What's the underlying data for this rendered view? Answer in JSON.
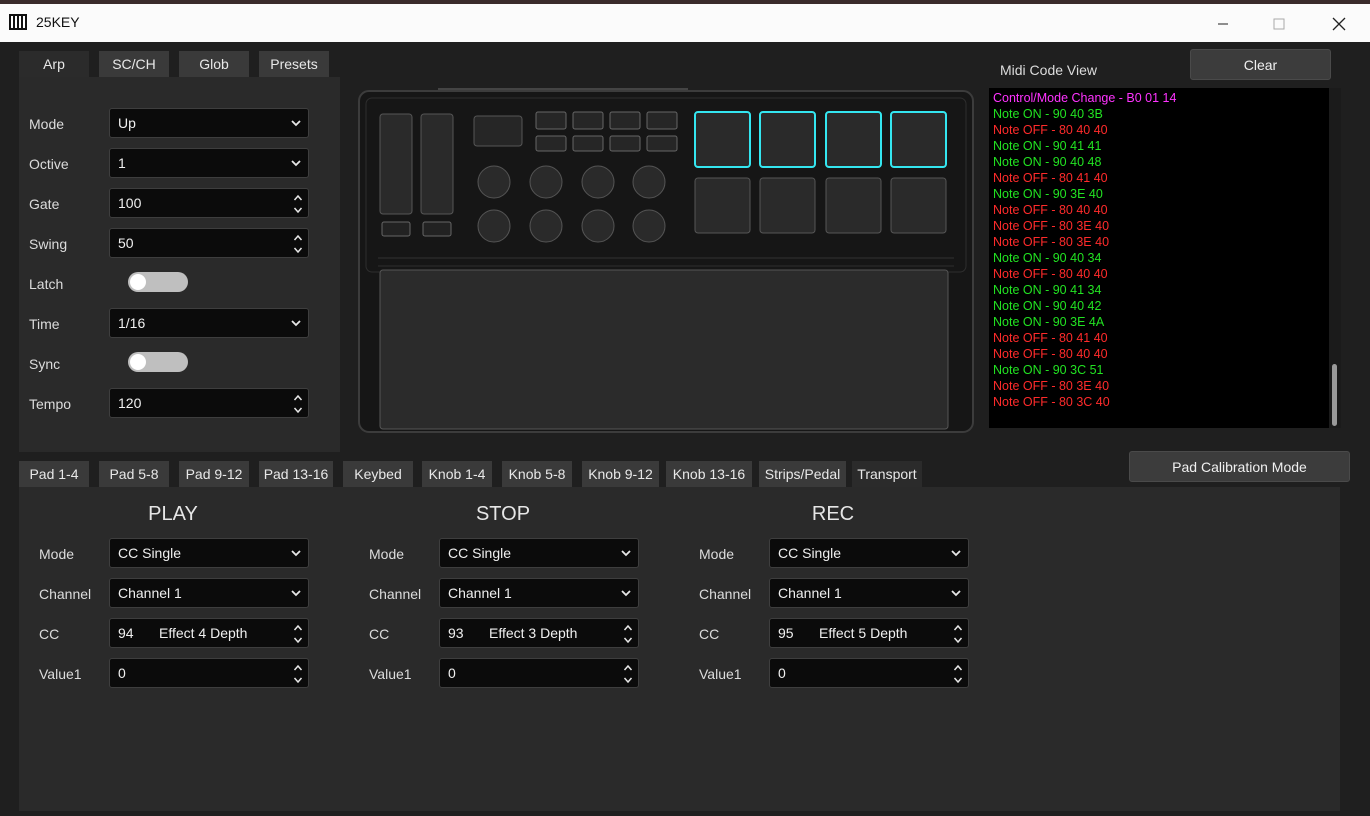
{
  "window": {
    "title": "25KEY",
    "app_icon": "piano-icon"
  },
  "top_tabs": [
    {
      "label": "Arp"
    },
    {
      "label": "SC/CH"
    },
    {
      "label": "Glob"
    },
    {
      "label": "Presets"
    }
  ],
  "arp": {
    "mode": {
      "label": "Mode",
      "value": "Up"
    },
    "octive": {
      "label": "Octive",
      "value": "1"
    },
    "gate": {
      "label": "Gate",
      "value": "100"
    },
    "swing": {
      "label": "Swing",
      "value": "50"
    },
    "latch": {
      "label": "Latch",
      "on": false
    },
    "time": {
      "label": "Time",
      "value": "1/16"
    },
    "sync": {
      "label": "Sync",
      "on": false
    },
    "tempo": {
      "label": "Tempo",
      "value": "120"
    }
  },
  "midi": {
    "title": "Midi Code View",
    "clear_label": "Clear",
    "colors": {
      "control": "#ff33ff",
      "note_on": "#22e322",
      "note_off": "#ff2b2b"
    },
    "lines": [
      {
        "text": "Control/Mode Change - B0 01 14",
        "kind": "control"
      },
      {
        "text": "Note ON - 90 40 3B",
        "kind": "note_on"
      },
      {
        "text": "Note OFF - 80 40 40",
        "kind": "note_off"
      },
      {
        "text": "Note ON - 90 41 41",
        "kind": "note_on"
      },
      {
        "text": "Note ON - 90 40 48",
        "kind": "note_on"
      },
      {
        "text": "Note OFF - 80 41 40",
        "kind": "note_off"
      },
      {
        "text": "Note ON - 90 3E 40",
        "kind": "note_on"
      },
      {
        "text": "Note OFF - 80 40 40",
        "kind": "note_off"
      },
      {
        "text": "Note OFF - 80 3E 40",
        "kind": "note_off"
      },
      {
        "text": "Note OFF - 80 3E 40",
        "kind": "note_off"
      },
      {
        "text": "Note ON - 90 40 34",
        "kind": "note_on"
      },
      {
        "text": "Note OFF - 80 40 40",
        "kind": "note_off"
      },
      {
        "text": "Note ON - 90 41 34",
        "kind": "note_on"
      },
      {
        "text": "Note ON - 90 40 42",
        "kind": "note_on"
      },
      {
        "text": "Note ON - 90 3E 4A",
        "kind": "note_on"
      },
      {
        "text": "Note OFF - 80 41 40",
        "kind": "note_off"
      },
      {
        "text": "Note OFF - 80 40 40",
        "kind": "note_off"
      },
      {
        "text": "Note ON - 90 3C 51",
        "kind": "note_on"
      },
      {
        "text": "Note OFF - 80 3E 40",
        "kind": "note_off"
      },
      {
        "text": "Note OFF - 80 3C 40",
        "kind": "note_off"
      }
    ]
  },
  "device": {
    "accent": "#34e6f0"
  },
  "pad_calibration_label": "Pad Calibration Mode",
  "bottom_tabs": [
    {
      "label": "Pad 1-4"
    },
    {
      "label": "Pad 5-8"
    },
    {
      "label": "Pad 9-12"
    },
    {
      "label": "Pad 13-16"
    },
    {
      "label": "Keybed"
    },
    {
      "label": "Knob 1-4"
    },
    {
      "label": "Knob 5-8"
    },
    {
      "label": "Knob 9-12"
    },
    {
      "label": "Knob 13-16"
    },
    {
      "label": "Strips/Pedal"
    },
    {
      "label": "Transport"
    }
  ],
  "transport": {
    "labels": {
      "mode": "Mode",
      "channel": "Channel",
      "cc": "CC",
      "value1": "Value1"
    },
    "play": {
      "title": "PLAY",
      "mode": "CC Single",
      "channel": "Channel 1",
      "cc_num": "94",
      "cc_name": "Effect 4 Depth",
      "value1": "0"
    },
    "stop": {
      "title": "STOP",
      "mode": "CC Single",
      "channel": "Channel 1",
      "cc_num": "93",
      "cc_name": "Effect 3 Depth",
      "value1": "0"
    },
    "rec": {
      "title": "REC",
      "mode": "CC Single",
      "channel": "Channel 1",
      "cc_num": "95",
      "cc_name": "Effect 5 Depth",
      "value1": "0"
    }
  }
}
